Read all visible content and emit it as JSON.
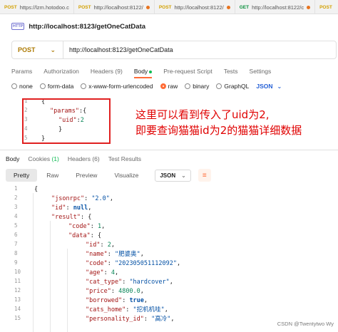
{
  "tabs": [
    {
      "method": "POST",
      "label": "https://lzm.hotodoo.c",
      "dot": false
    },
    {
      "method": "POST",
      "label": "http://localhost:8122/",
      "dot": true
    },
    {
      "method": "POST",
      "label": "http://localhost:8122/",
      "dot": true
    },
    {
      "method": "GET",
      "label": "http://localhost:8122/c",
      "dot": true
    },
    {
      "method": "POST",
      "label": "",
      "dot": true
    }
  ],
  "request": {
    "icon": "HTTP",
    "title": "http://localhost:8123/getOneCatData",
    "method": "POST",
    "url": "http://localhost:8123/getOneCatData"
  },
  "req_tabs": [
    {
      "label": "Params",
      "active": false
    },
    {
      "label": "Authorization",
      "active": false
    },
    {
      "label": "Headers (9)",
      "active": false
    },
    {
      "label": "Body",
      "active": true,
      "dot": true
    },
    {
      "label": "Pre-request Script",
      "active": false
    },
    {
      "label": "Tests",
      "active": false
    },
    {
      "label": "Settings",
      "active": false
    }
  ],
  "body_types": [
    {
      "label": "none",
      "selected": false
    },
    {
      "label": "form-data",
      "selected": false
    },
    {
      "label": "x-www-form-urlencoded",
      "selected": false
    },
    {
      "label": "raw",
      "selected": true
    },
    {
      "label": "binary",
      "selected": false
    },
    {
      "label": "GraphQL",
      "selected": false
    }
  ],
  "body_lang": "JSON",
  "req_lines": [
    {
      "n": "1",
      "t": "{"
    },
    {
      "n": "2",
      "t": "\"params\":{",
      "k": "\"params\"",
      "rest": ":{"
    },
    {
      "n": "3",
      "t": "\"uid\":2",
      "k": "\"uid\"",
      "rest": ":",
      "v": "2"
    },
    {
      "n": "4",
      "t": "}"
    },
    {
      "n": "5",
      "t": "}"
    }
  ],
  "annotation": {
    "line1": "这里可以看到传入了uid为2,",
    "line2": "即要查询猫猫id为2的猫猫详细数据"
  },
  "res_tabs": [
    {
      "label": "Body",
      "active": true
    },
    {
      "label": "Cookies",
      "count": "(1)"
    },
    {
      "label": "Headers (6)"
    },
    {
      "label": "Test Results"
    }
  ],
  "view_buttons": [
    {
      "label": "Pretty",
      "active": true
    },
    {
      "label": "Raw",
      "active": false
    },
    {
      "label": "Preview",
      "active": false
    },
    {
      "label": "Visualize",
      "active": false
    }
  ],
  "res_lang": "JSON",
  "res_lines": [
    {
      "n": "1",
      "parts": [
        {
          "c": "p",
          "s": "{"
        }
      ]
    },
    {
      "n": "2",
      "parts": [
        {
          "c": "key",
          "s": "\"jsonrpc\""
        },
        {
          "c": "p",
          "s": ": "
        },
        {
          "c": "str",
          "s": "\"2.0\""
        },
        {
          "c": "p",
          "s": ","
        }
      ]
    },
    {
      "n": "3",
      "parts": [
        {
          "c": "key",
          "s": "\"id\""
        },
        {
          "c": "p",
          "s": ": "
        },
        {
          "c": "kw",
          "s": "null"
        },
        {
          "c": "p",
          "s": ","
        }
      ]
    },
    {
      "n": "4",
      "parts": [
        {
          "c": "key",
          "s": "\"result\""
        },
        {
          "c": "p",
          "s": ": {"
        }
      ]
    },
    {
      "n": "5",
      "parts": [
        {
          "c": "key",
          "s": "\"code\""
        },
        {
          "c": "p",
          "s": ": "
        },
        {
          "c": "num",
          "s": "1"
        },
        {
          "c": "p",
          "s": ","
        }
      ]
    },
    {
      "n": "6",
      "parts": [
        {
          "c": "key",
          "s": "\"data\""
        },
        {
          "c": "p",
          "s": ": {"
        }
      ]
    },
    {
      "n": "7",
      "parts": [
        {
          "c": "key",
          "s": "\"id\""
        },
        {
          "c": "p",
          "s": ": "
        },
        {
          "c": "num",
          "s": "2"
        },
        {
          "c": "p",
          "s": ","
        }
      ]
    },
    {
      "n": "8",
      "parts": [
        {
          "c": "key",
          "s": "\"name\""
        },
        {
          "c": "p",
          "s": ": "
        },
        {
          "c": "str",
          "s": "\"肥婆奥\""
        },
        {
          "c": "p",
          "s": ","
        }
      ]
    },
    {
      "n": "9",
      "parts": [
        {
          "c": "key",
          "s": "\"code\""
        },
        {
          "c": "p",
          "s": ": "
        },
        {
          "c": "str",
          "s": "\"202305051112092\""
        },
        {
          "c": "p",
          "s": ","
        }
      ]
    },
    {
      "n": "10",
      "parts": [
        {
          "c": "key",
          "s": "\"age\""
        },
        {
          "c": "p",
          "s": ": "
        },
        {
          "c": "num",
          "s": "4"
        },
        {
          "c": "p",
          "s": ","
        }
      ]
    },
    {
      "n": "11",
      "parts": [
        {
          "c": "key",
          "s": "\"cat_type\""
        },
        {
          "c": "p",
          "s": ": "
        },
        {
          "c": "str",
          "s": "\"hardcover\""
        },
        {
          "c": "p",
          "s": ","
        }
      ]
    },
    {
      "n": "12",
      "parts": [
        {
          "c": "key",
          "s": "\"price\""
        },
        {
          "c": "p",
          "s": ": "
        },
        {
          "c": "num",
          "s": "4800.0"
        },
        {
          "c": "p",
          "s": ","
        }
      ]
    },
    {
      "n": "13",
      "parts": [
        {
          "c": "key",
          "s": "\"borrowed\""
        },
        {
          "c": "p",
          "s": ": "
        },
        {
          "c": "kw",
          "s": "true"
        },
        {
          "c": "p",
          "s": ","
        }
      ]
    },
    {
      "n": "14",
      "parts": [
        {
          "c": "key",
          "s": "\"cats_home\""
        },
        {
          "c": "p",
          "s": ": "
        },
        {
          "c": "str",
          "s": "\"挖机机哇\""
        },
        {
          "c": "p",
          "s": ","
        }
      ]
    },
    {
      "n": "15",
      "parts": [
        {
          "c": "key",
          "s": "\"personality_id\""
        },
        {
          "c": "p",
          "s": ": "
        },
        {
          "c": "str",
          "s": "\"高冷\""
        },
        {
          "c": "p",
          "s": ","
        }
      ]
    }
  ],
  "watermark": "CSDN @Twentytwo Wy"
}
